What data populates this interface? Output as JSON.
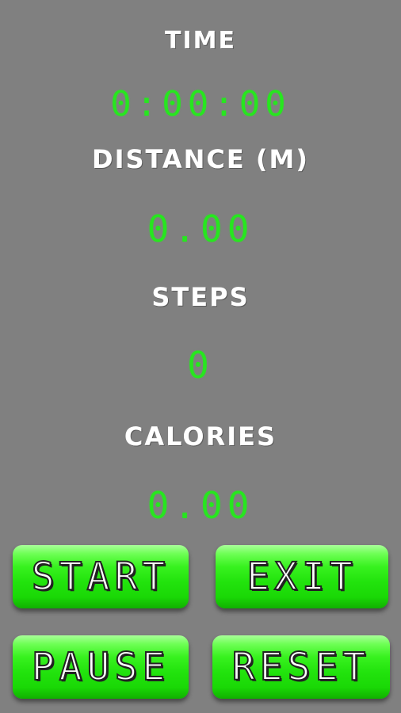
{
  "stats": {
    "time_label": "TIME",
    "time_value": "0:00:00",
    "distance_label": "DISTANCE (m)",
    "distance_value": "0.00",
    "steps_label": "STEPS",
    "steps_value": "0",
    "calories_label": "CALORIES",
    "calories_value": "0.00"
  },
  "buttons": {
    "start": "START",
    "exit": "EXIT",
    "pause": "PAUSE",
    "reset": "RESET"
  },
  "colors": {
    "background": "#808080",
    "label_text": "#ffffff",
    "readout_green": "#27e61f",
    "button_green": "#22e30d"
  }
}
